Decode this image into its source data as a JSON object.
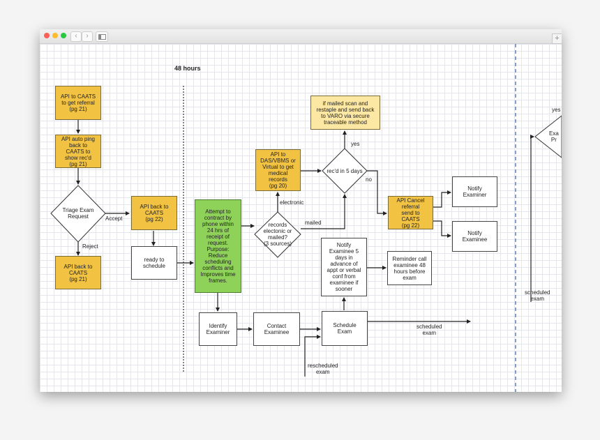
{
  "heading": "48 hours",
  "nodes": {
    "api_caats_referral": "API to CAATS\nto get referral\n(pg 21)",
    "api_auto_ping": "API auto ping\nback to\nCAATS to\nshow rec'd\n(pg 21)",
    "triage": "Triage Exam\nRequest",
    "api_back_caats_left": "API back to\nCAATS\n(pg 21)",
    "api_back_caats_22": "API back to\nCAATS\n(pg 22)",
    "ready_schedule": "ready to\nschedule",
    "attempt_contract": "Attempt to\ncontract by\nphone within\n24 hrs of\nreceipt of\nrequest.\nPurpose:\nReduce\nscheduling\nconflicts and\nImproves time\nframes.",
    "identify_examiner": "Identify\nExaminer",
    "contact_examinee": "Contact\nExaminee",
    "schedule_exam": "Schedule\nExam",
    "records_decision": "records\nelectonic or\nmailed?\n(3 sources)",
    "api_das": "API to\nDAS/VBMS or\nVirtual to get\nmedical\nrecords\n(pg 20)",
    "recd_5_days": "rec'd in 5 days",
    "if_mailed": "if mailed scan and\nrestaple and send back\nto VARO via secure\ntraceable method",
    "api_cancel": "API Cancel\nreferral\nsend to\nCAATS\n(pg 22)",
    "notify_examiner": "Notify\nExaminer",
    "notify_examinee": "Notify\nExaminee",
    "notify_examinee_5": "Notify\nExaminee 5\ndays in\nadvance of\nappt or verbal\nconf from\nexaminee if\nsooner",
    "reminder_call": "Reminder call\nexaminee 48\nhours before\nexam",
    "partial_diamond": "Exa\nPr"
  },
  "edge_labels": {
    "accept": "Accept",
    "reject": "Reject",
    "electronic": "electronic",
    "mailed": "mailed",
    "yes": "yes",
    "no": "no",
    "scheduled_exam": "scheduled\nexam",
    "rescheduled_exam": "rescheduled\nexam",
    "scheduled_exam_right": "scheduled\nexam",
    "yes_right": "yes"
  },
  "colors": {
    "orange": "#f2c343",
    "light_yellow": "#fde8a3",
    "green": "#8fd25a"
  }
}
